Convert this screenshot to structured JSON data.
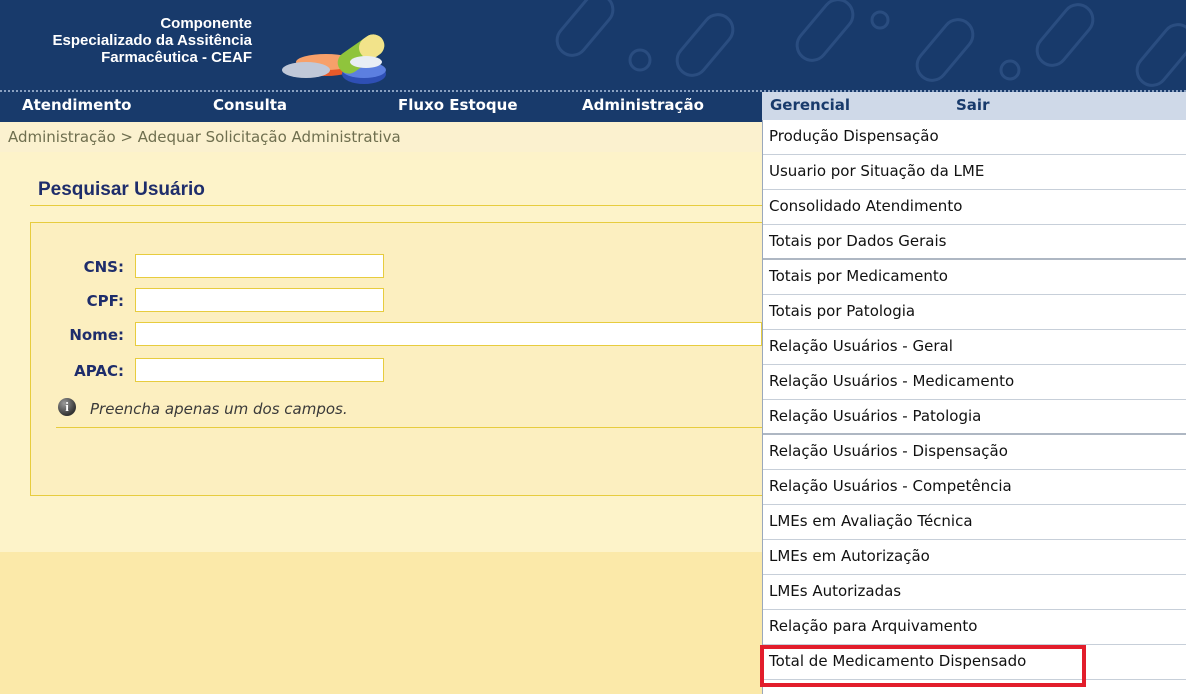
{
  "header": {
    "logo_line1": "Componente",
    "logo_line2": "Especializado da Assitência",
    "logo_line3": "Farmacêutica - CEAF"
  },
  "nav": {
    "atendimento": "Atendimento",
    "consulta": "Consulta",
    "fluxo_estoque": "Fluxo Estoque",
    "administracao": "Administração",
    "gerencial": "Gerencial",
    "sair": "Sair"
  },
  "breadcrumb": "Administração > Adequar Solicitação Administrativa",
  "search": {
    "title": "Pesquisar Usuário",
    "cns_label": "CNS:",
    "cpf_label": "CPF:",
    "nome_label": "Nome:",
    "apac_label": "APAC:",
    "hint": "Preencha apenas um dos campos.",
    "hint_icon": "i"
  },
  "gerencial_menu": {
    "items": [
      "Produção Dispensação",
      "Usuario por Situação da LME",
      "Consolidado Atendimento",
      "Totais por Dados Gerais",
      "Totais por Medicamento",
      "Totais por Patologia",
      "Relação Usuários - Geral",
      "Relação Usuários - Medicamento",
      "Relação Usuários - Patologia",
      "Relação Usuários - Dispensação",
      "Relação Usuários - Competência",
      "LMEs em Avaliação Técnica",
      "LMEs em Autorização",
      "LMEs Autorizadas",
      "Relação para Arquivamento",
      "Total de Medicamento Dispensado"
    ]
  },
  "colors": {
    "navy": "#183a6b",
    "highlight": "#e21d2b",
    "panel_border": "#e7cc3e"
  }
}
